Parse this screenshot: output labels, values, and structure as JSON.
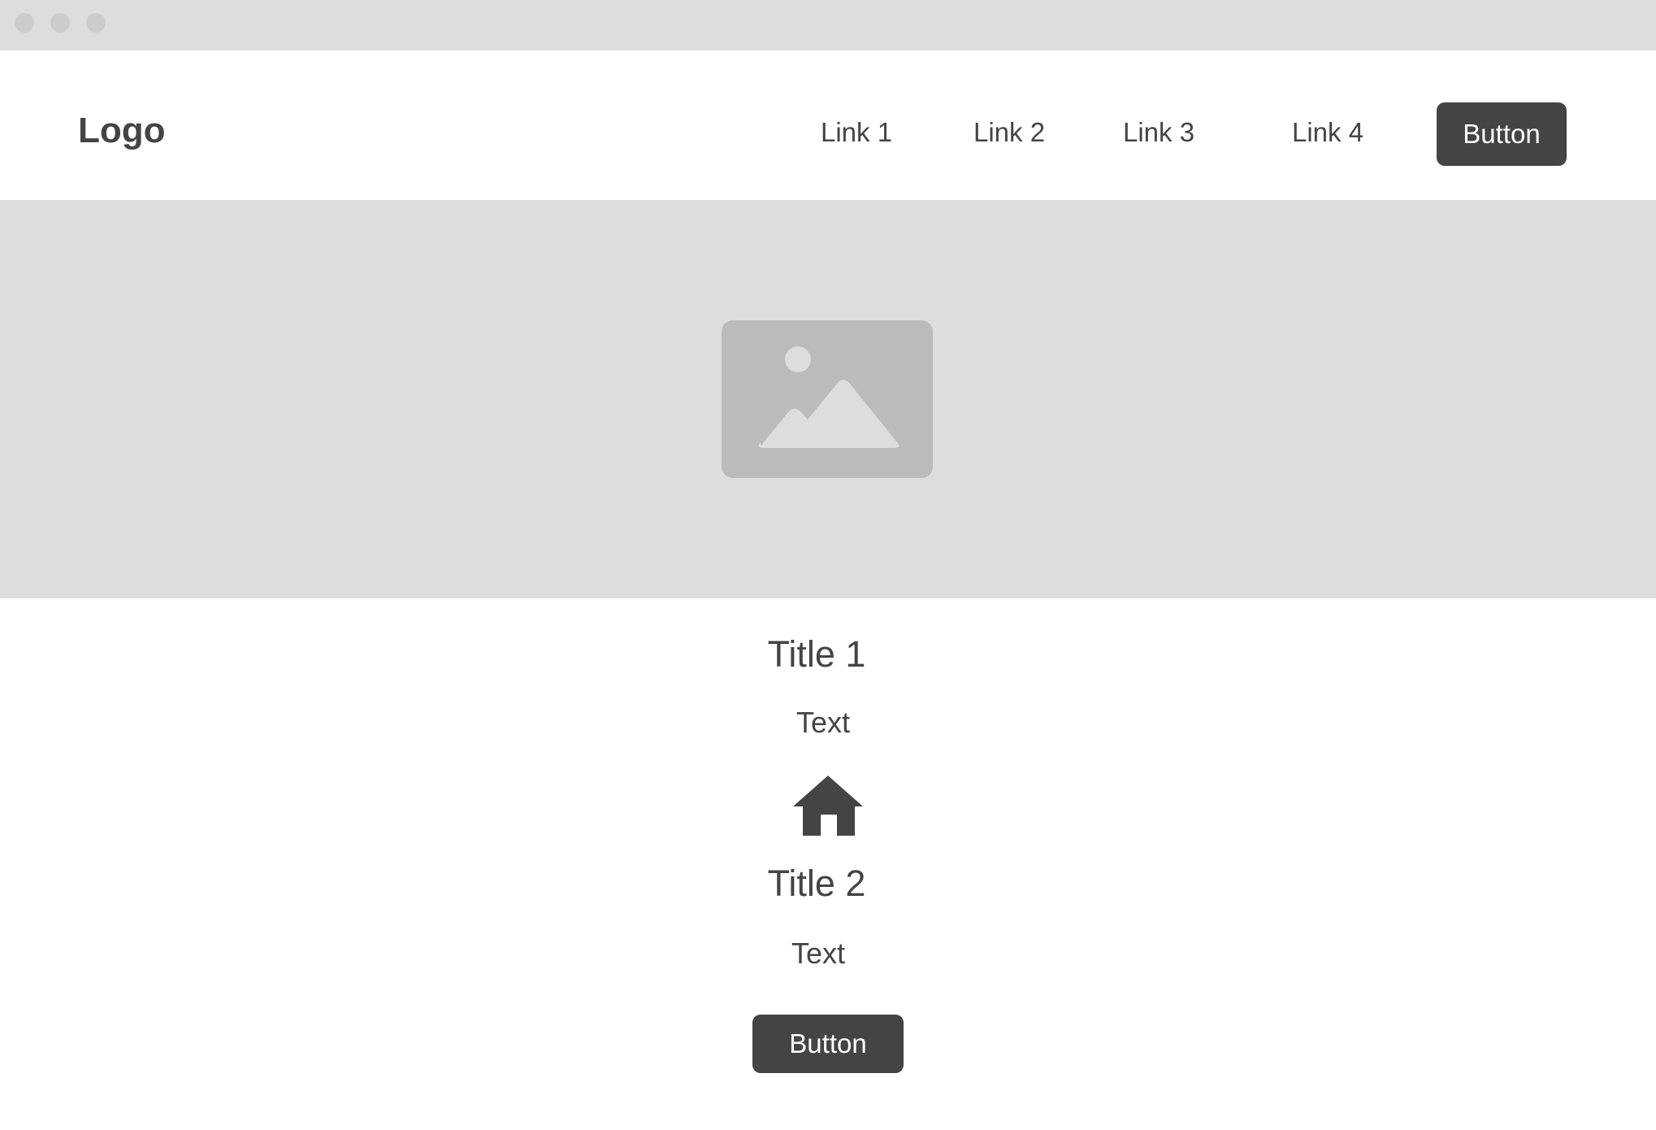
{
  "header": {
    "logo": "Logo",
    "nav": [
      {
        "label": "Link 1"
      },
      {
        "label": "Link 2"
      },
      {
        "label": "Link 3"
      },
      {
        "label": "Link 4"
      }
    ],
    "button_label": "Button"
  },
  "hero": {
    "image_icon": "image-placeholder-icon"
  },
  "content": {
    "title1": "Title 1",
    "text1": "Text",
    "icon": "home-icon",
    "title2": "Title 2",
    "text2": "Text",
    "button_label": "Button"
  },
  "colors": {
    "dark": "#444444",
    "placeholder_bg": "#dddddd",
    "placeholder_icon": "#bbbbbb"
  }
}
